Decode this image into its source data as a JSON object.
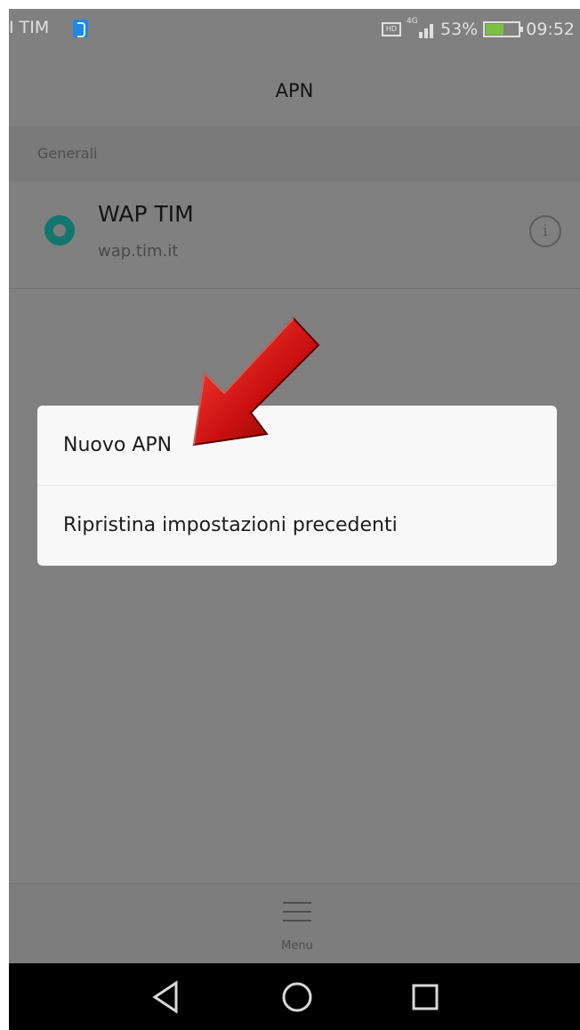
{
  "status_bar": {
    "carrier": "I TIM",
    "network_tag": "4G",
    "battery_percent": "53%",
    "time": "09:52",
    "battery_level": 0.53
  },
  "header": {
    "title": "APN"
  },
  "section": {
    "label": "Generali"
  },
  "apn_list": [
    {
      "name": "WAP TIM",
      "address": "wap.tim.it",
      "selected": true,
      "icon": "info-icon"
    }
  ],
  "dialog": {
    "items": [
      {
        "label": "Nuovo APN"
      },
      {
        "label": "Ripristina impostazioni precedenti"
      }
    ]
  },
  "bottom_menu": {
    "icon": "hamburger-menu-icon",
    "label": "Menu"
  },
  "nav_bar": {
    "icons": [
      "back-icon",
      "home-icon",
      "recent-apps-icon"
    ]
  },
  "colors": {
    "accent": "#13766e",
    "arrow": "#cc1111",
    "overlay": "#808080",
    "dialog_bg": "#f8f8f8",
    "nav_bar": "#000000"
  }
}
